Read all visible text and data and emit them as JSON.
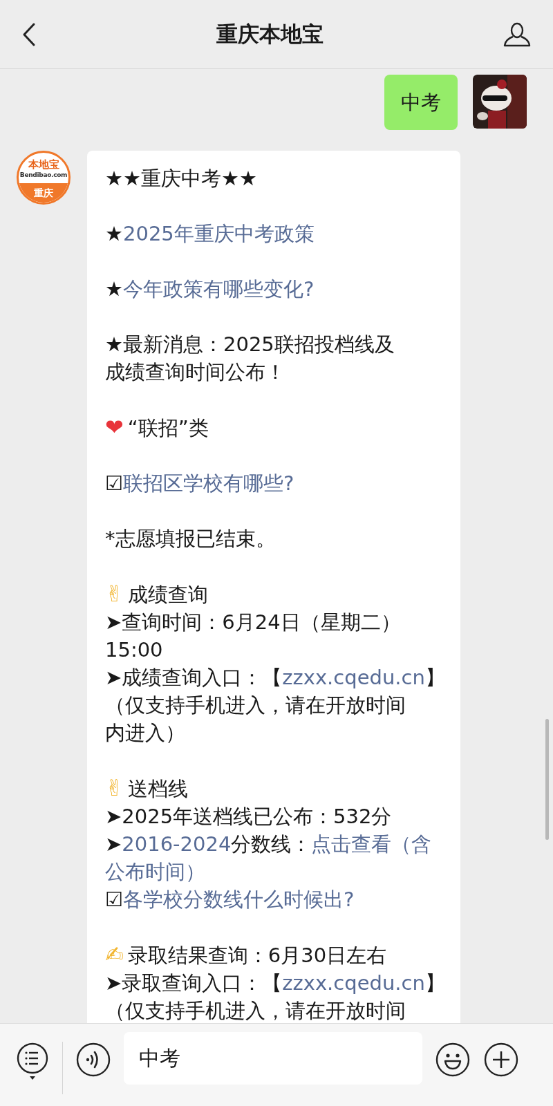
{
  "header": {
    "title": "重庆本地宝"
  },
  "messages": [
    {
      "kind": "outgoing",
      "text": "中考"
    },
    {
      "kind": "incoming",
      "logo": {
        "brand": "本地宝",
        "site": "Bendibao.com",
        "city": "重庆"
      },
      "blocks": [
        [
          [
            {
              "kind": "text",
              "text": "★★重庆中考★★"
            }
          ]
        ],
        [
          [
            {
              "kind": "text",
              "text": "★"
            },
            {
              "kind": "link",
              "text": "2025年重庆中考政策"
            }
          ]
        ],
        [
          [
            {
              "kind": "text",
              "text": "★"
            },
            {
              "kind": "link",
              "text": "今年政策有哪些变化?"
            }
          ]
        ],
        [
          [
            {
              "kind": "text",
              "text": "★最新消息：2025联招投档线及"
            }
          ],
          [
            {
              "kind": "text",
              "text": "成绩查询时间公布！"
            }
          ]
        ],
        [
          [
            {
              "kind": "emoji",
              "text": "❤",
              "color": "#e8333a"
            },
            {
              "kind": "text",
              "text": "“联招”类"
            }
          ]
        ],
        [
          [
            {
              "kind": "text",
              "text": "☑"
            },
            {
              "kind": "link",
              "text": "联招区学校有哪些?"
            }
          ]
        ],
        [
          [
            {
              "kind": "text",
              "text": "*志愿填报已结束。"
            }
          ]
        ],
        [
          [
            {
              "kind": "emoji",
              "text": "✌",
              "color": "#f2b632"
            },
            {
              "kind": "text",
              "text": "成绩查询"
            }
          ],
          [
            {
              "kind": "text",
              "text": "➤查询时间：6月24日（星期二）"
            }
          ],
          [
            {
              "kind": "text",
              "text": "15:00"
            }
          ],
          [
            {
              "kind": "text",
              "text": "➤成绩查询入口：【"
            },
            {
              "kind": "link",
              "text": "zzxx.cqedu.cn"
            },
            {
              "kind": "text",
              "text": "】"
            }
          ],
          [
            {
              "kind": "text",
              "text": "（仅支持手机进入，请在开放时间"
            }
          ],
          [
            {
              "kind": "text",
              "text": "内进入）"
            }
          ]
        ],
        [
          [
            {
              "kind": "emoji",
              "text": "✌",
              "color": "#f2b632"
            },
            {
              "kind": "text",
              "text": "送档线"
            }
          ],
          [
            {
              "kind": "text",
              "text": "➤2025年送档线已公布：532分"
            }
          ],
          [
            {
              "kind": "text",
              "text": "➤"
            },
            {
              "kind": "link",
              "text": "2016-2024"
            },
            {
              "kind": "text",
              "text": "分数线："
            },
            {
              "kind": "link",
              "text": "点击查看（含"
            }
          ],
          [
            {
              "kind": "link",
              "text": "公布时间）"
            }
          ],
          [
            {
              "kind": "text",
              "text": "☑"
            },
            {
              "kind": "link",
              "text": "各学校分数线什么时候出?"
            }
          ]
        ],
        [
          [
            {
              "kind": "emoji",
              "text": "✍",
              "color": "#f2b632"
            },
            {
              "kind": "text",
              "text": "录取结果查询：6月30日左右"
            }
          ],
          [
            {
              "kind": "text",
              "text": "➤录取查询入口：【"
            },
            {
              "kind": "link",
              "text": "zzxx.cqedu.cn"
            },
            {
              "kind": "text",
              "text": "】"
            }
          ],
          [
            {
              "kind": "text",
              "text": "（仅支持手机进入，请在开放时间"
            }
          ]
        ]
      ]
    }
  ],
  "input": {
    "value": "中考"
  }
}
